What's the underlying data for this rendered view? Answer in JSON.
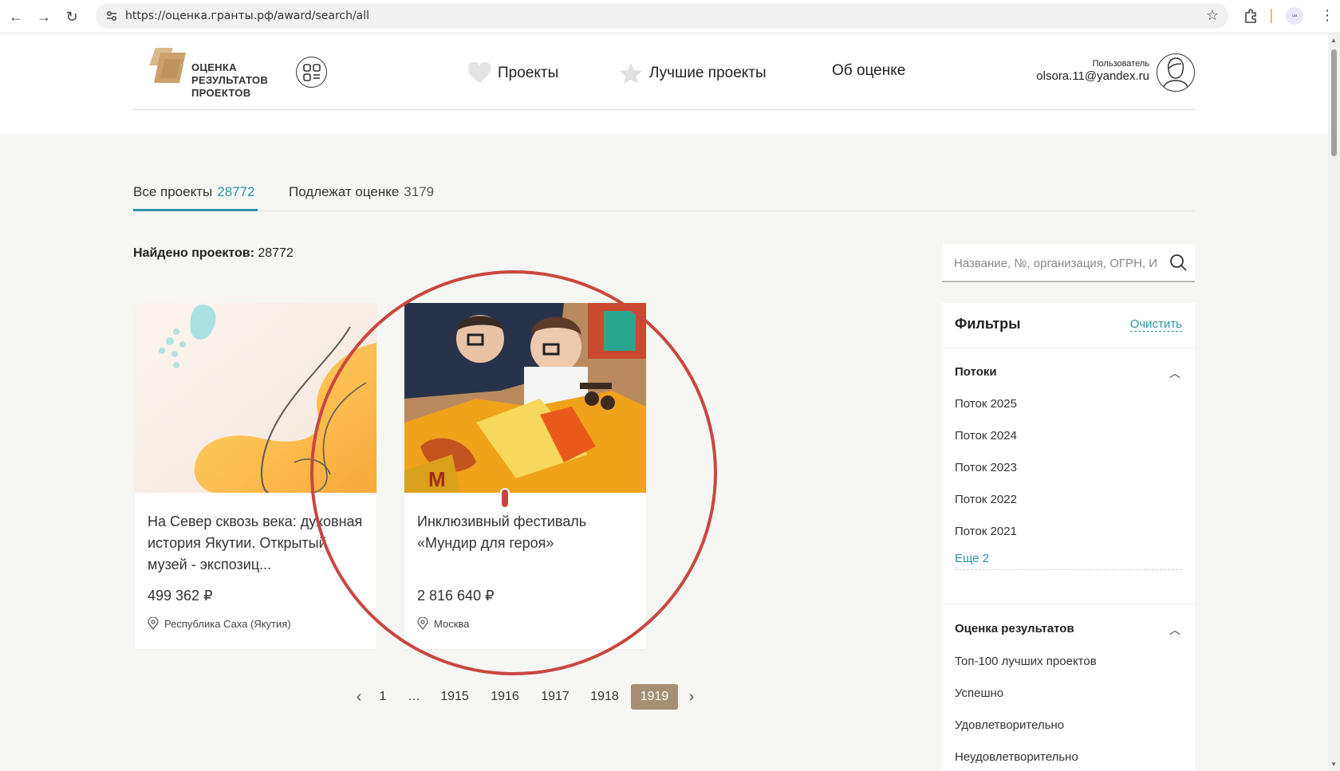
{
  "browser": {
    "url": "https://оценка.гранты.рф/award/search/all",
    "back_icon": "←",
    "forward_icon": "→",
    "reload_icon": "↻",
    "star_icon": "☆",
    "menu_icon": "⋮",
    "profile_chip": "ᵘᵃ"
  },
  "header": {
    "logo_lines": [
      "ОЦЕНКА",
      "РЕЗУЛЬТАТОВ",
      "ПРОЕКТОВ"
    ],
    "nav": [
      {
        "label": "Проекты",
        "icon": "heart-icon"
      },
      {
        "label": "Лучшие проекты",
        "icon": "star-icon"
      },
      {
        "label": "Об оценке"
      }
    ],
    "user_label": "Пользователь",
    "user_email": "olsora.11@yandex.ru"
  },
  "tabs": [
    {
      "label": "Все проекты",
      "count": "28772",
      "active": true
    },
    {
      "label": "Подлежат оценке",
      "count": "3179",
      "active": false
    }
  ],
  "found": {
    "label": "Найдено проектов:",
    "count": "28772"
  },
  "cards": [
    {
      "title": "На Север сквозь века: духовная история Якутии. Открытый музей - экспозиц...",
      "price": "499 362 ₽",
      "location": "Республика Саха (Якутия)"
    },
    {
      "title": "Инклюзивный фестиваль «Мундир для героя»",
      "price": "2 816 640 ₽",
      "location": "Москва"
    }
  ],
  "pagination": {
    "pages": [
      "1",
      "…",
      "1915",
      "1916",
      "1917",
      "1918",
      "1919"
    ],
    "current": "1919",
    "prev_icon": "‹",
    "next_icon": "›"
  },
  "search": {
    "placeholder": "Название, №, организация, ОГРН, И"
  },
  "filters": {
    "title": "Фильтры",
    "clear": "Очистить",
    "sections": [
      {
        "title": "Потоки",
        "options": [
          "Поток 2025",
          "Поток 2024",
          "Поток 2023",
          "Поток 2022",
          "Поток 2021"
        ],
        "more": "Еще 2"
      },
      {
        "title": "Оценка результатов",
        "options": [
          "Топ-100 лучших проектов",
          "Успешно",
          "Удовлетворительно",
          "Неудовлетворительно"
        ]
      }
    ],
    "chevron_icon": "︿"
  },
  "colors": {
    "accent": "#2a93a3",
    "pager_active": "#a58f73",
    "highlight": "#c9473f"
  }
}
